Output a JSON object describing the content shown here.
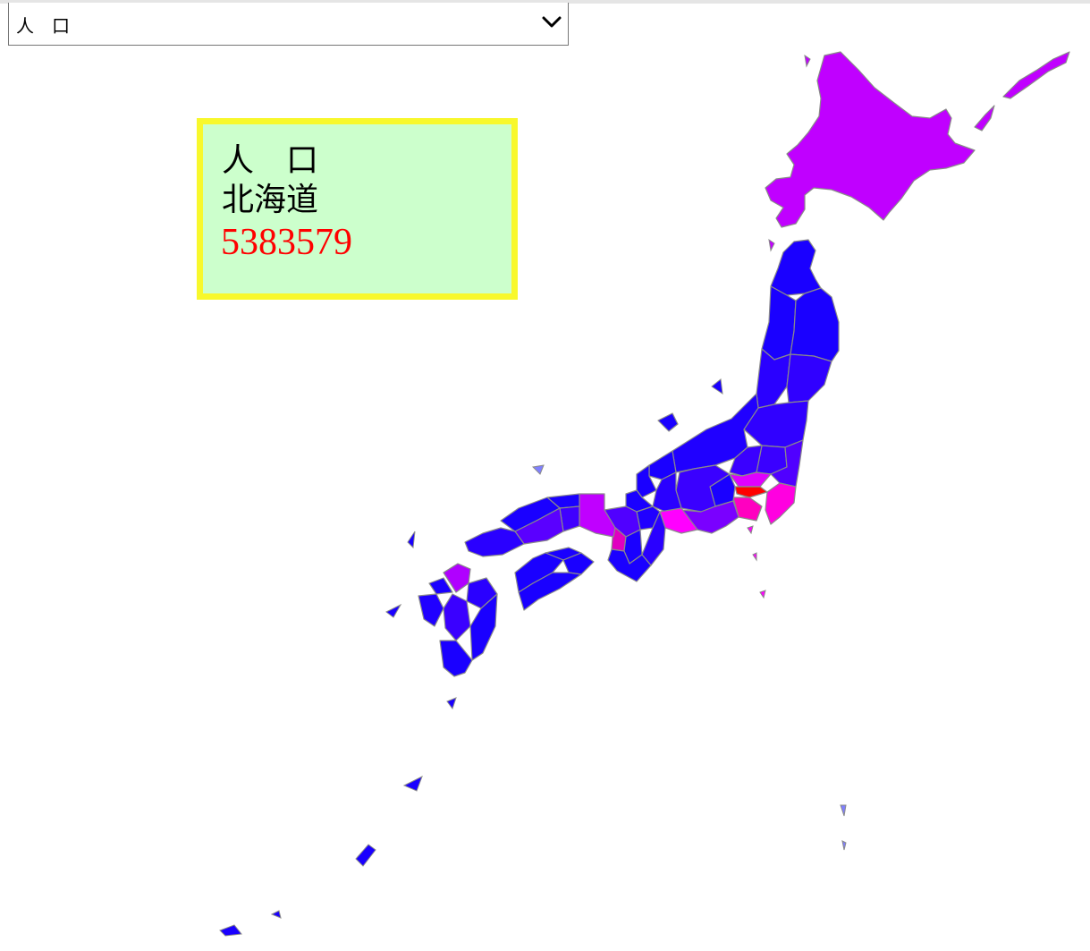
{
  "selector": {
    "selected": "人　口",
    "arrow_icon": "chevron-down-icon"
  },
  "info": {
    "label": "人　口",
    "region": "北海道",
    "value": "5383579",
    "value_color": "#ff0000",
    "background": "#ccffcc",
    "border_color": "#f8f82c"
  },
  "map": {
    "legend": "none",
    "color_scale": [
      "#1a00ff",
      "#c000ff",
      "#ff00ff",
      "#ff0000"
    ]
  }
}
